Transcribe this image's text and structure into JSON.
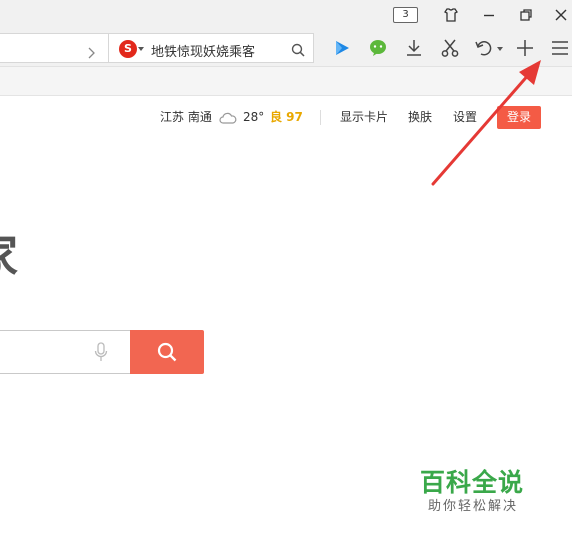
{
  "titlebar": {
    "tab_count": "3",
    "icons": [
      "skin-icon",
      "minimize-icon",
      "restore-icon",
      "close-icon"
    ]
  },
  "toolbar": {
    "search_engine_icon": "sogou-icon",
    "hot_search_text": "地铁惊现妖娆乘客",
    "icons": [
      "chevron-right-icon",
      "search-icon",
      "video-play-icon",
      "wechat-icon",
      "download-icon",
      "scissors-icon",
      "undo-icon",
      "plus-icon",
      "menu-icon"
    ]
  },
  "page": {
    "location": "江苏 南通",
    "weather_icon": "cloud-icon",
    "temperature": "28°",
    "air_quality": "良 97",
    "nav": {
      "show_cards": "显示卡片",
      "change_skin": "换肤",
      "settings": "设置",
      "login": "登录"
    },
    "logo_fragment": "家",
    "search_icons": [
      "microphone-icon",
      "search-icon"
    ]
  },
  "annotation": {
    "arrow_color": "#e53935"
  },
  "watermark": {
    "title": "百科全说",
    "subtitle": "助你轻松解决"
  },
  "colors": {
    "accent": "#f26651",
    "login_bg": "#f45b45",
    "air_quality": "#e9a800",
    "watermark_green": "#3aa84a"
  }
}
